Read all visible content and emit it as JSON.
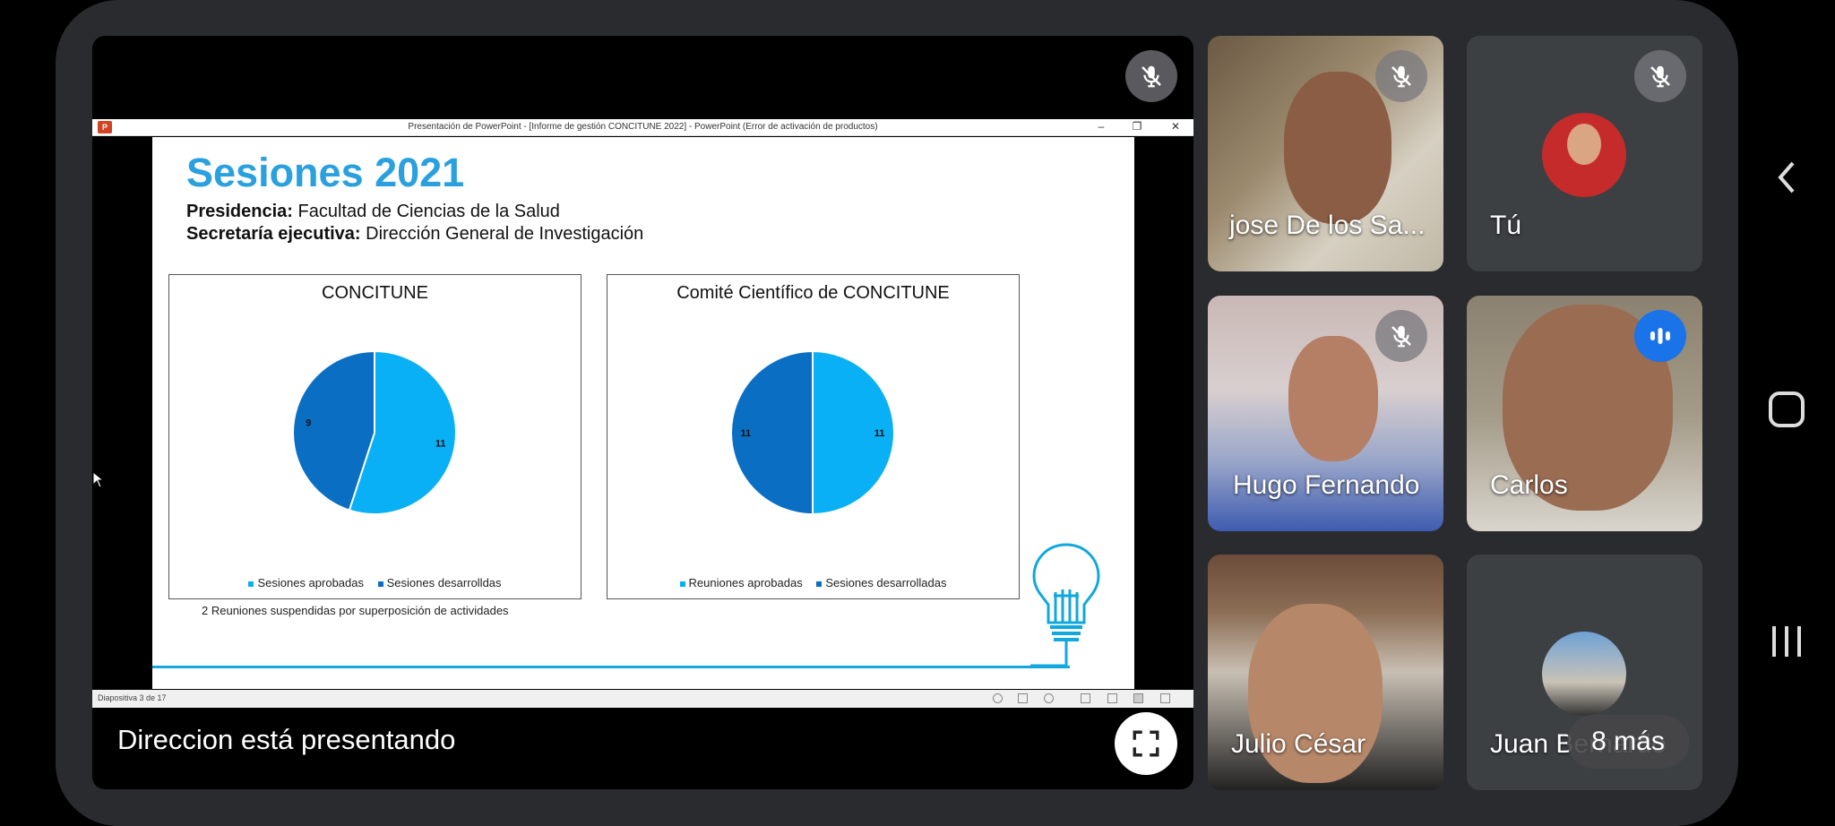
{
  "meeting": {
    "presenting_label": "Direccion  está presentando"
  },
  "ppt": {
    "window_title": "Presentación de PowerPoint - [Informe de gestión CONCITUNE 2022] - PowerPoint (Error de activación de productos)",
    "logo": "P",
    "status_slide": "Diapositiva 3 de 17",
    "controls": {
      "minimize": "–",
      "restore": "❐",
      "close": "✕"
    }
  },
  "slide": {
    "title": "Sesiones 2021",
    "presidencia_label": "Presidencia:",
    "presidencia_value": "Facultad de Ciencias de la Salud",
    "secretaria_label": "Secretaría ejecutiva:",
    "secretaria_value": "Dirección General de Investigación",
    "footnote": "2 Reuniones suspendidas por superposición de actividades"
  },
  "chart_data": [
    {
      "type": "pie",
      "title": "CONCITUNE",
      "categories": [
        "Sesiones aprobadas",
        "Sesiones desarrolldas"
      ],
      "values": [
        11,
        9
      ],
      "colors": [
        "#0ab0f5",
        "#0a6fc2"
      ],
      "legend": "bottom"
    },
    {
      "type": "pie",
      "title": "Comité Científico de CONCITUNE",
      "categories": [
        "Reuniones aprobadas",
        "Sesiones desarrolladas"
      ],
      "values": [
        11,
        11
      ],
      "colors": [
        "#0ab0f5",
        "#0a6fc2"
      ],
      "legend": "bottom"
    }
  ],
  "participants": [
    {
      "name": "jose De los Sa...",
      "muted": true
    },
    {
      "name": "Tú",
      "muted": true
    },
    {
      "name": "Hugo Fernando",
      "muted": true
    },
    {
      "name": "Carlos",
      "muted": false
    },
    {
      "name": "Julio César",
      "muted": false
    },
    {
      "name": "Juan Bernardo",
      "more_label": "8 más"
    }
  ],
  "colors": {
    "accent_blue": "#2aa1de",
    "slice_light": "#0ab0f5",
    "slice_dark": "#0a6fc2",
    "speaking_blue": "#1a73e8"
  }
}
